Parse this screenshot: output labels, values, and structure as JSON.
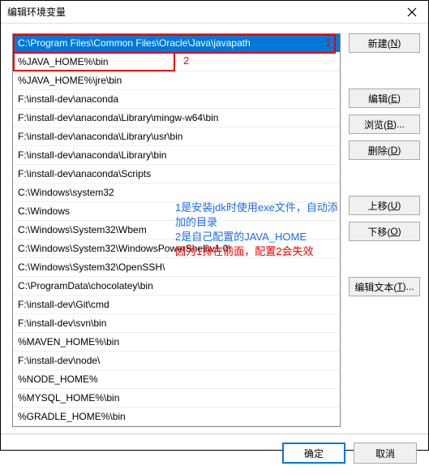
{
  "title": "编辑环境变量",
  "list": {
    "items": [
      "C:\\Program Files\\Common Files\\Oracle\\Java\\javapath",
      "%JAVA_HOME%\\bin",
      "%JAVA_HOME%\\jre\\bin",
      "F:\\install-dev\\anaconda",
      "F:\\install-dev\\anaconda\\Library\\mingw-w64\\bin",
      "F:\\install-dev\\anaconda\\Library\\usr\\bin",
      "F:\\install-dev\\anaconda\\Library\\bin",
      "F:\\install-dev\\anaconda\\Scripts",
      "C:\\Windows\\system32",
      "C:\\Windows",
      "C:\\Windows\\System32\\Wbem",
      "C:\\Windows\\System32\\WindowsPowerShell\\v1.0\\",
      "C:\\Windows\\System32\\OpenSSH\\",
      "C:\\ProgramData\\chocolatey\\bin",
      "F:\\install-dev\\Git\\cmd",
      "F:\\install-dev\\svn\\bin",
      "%MAVEN_HOME%\\bin",
      "F:\\install-dev\\node\\",
      "%NODE_HOME%",
      "%MYSQL_HOME%\\bin",
      "%GRADLE_HOME%\\bin"
    ],
    "selected_index": 0
  },
  "red_labels": {
    "l1": "1",
    "l2": "2"
  },
  "annotations": {
    "line1": "1是安装jdk时使用exe文件，自动添加的目录",
    "line2": "2是自己配置的JAVA_HOME",
    "line3": "因为1排在前面，配置2会失效"
  },
  "buttons": {
    "new": {
      "text": "新建(",
      "key": "N",
      "suffix": ")"
    },
    "edit": {
      "text": "编辑(",
      "key": "E",
      "suffix": ")"
    },
    "browse": {
      "text": "浏览(",
      "key": "B",
      "suffix": ")..."
    },
    "delete": {
      "text": "删除(",
      "key": "D",
      "suffix": ")"
    },
    "up": {
      "text": "上移(",
      "key": "U",
      "suffix": ")"
    },
    "down": {
      "text": "下移(",
      "key": "O",
      "suffix": ")"
    },
    "edit_text": {
      "text": "编辑文本(",
      "key": "T",
      "suffix": ")..."
    }
  },
  "footer": {
    "ok": "确定",
    "cancel": "取消"
  }
}
